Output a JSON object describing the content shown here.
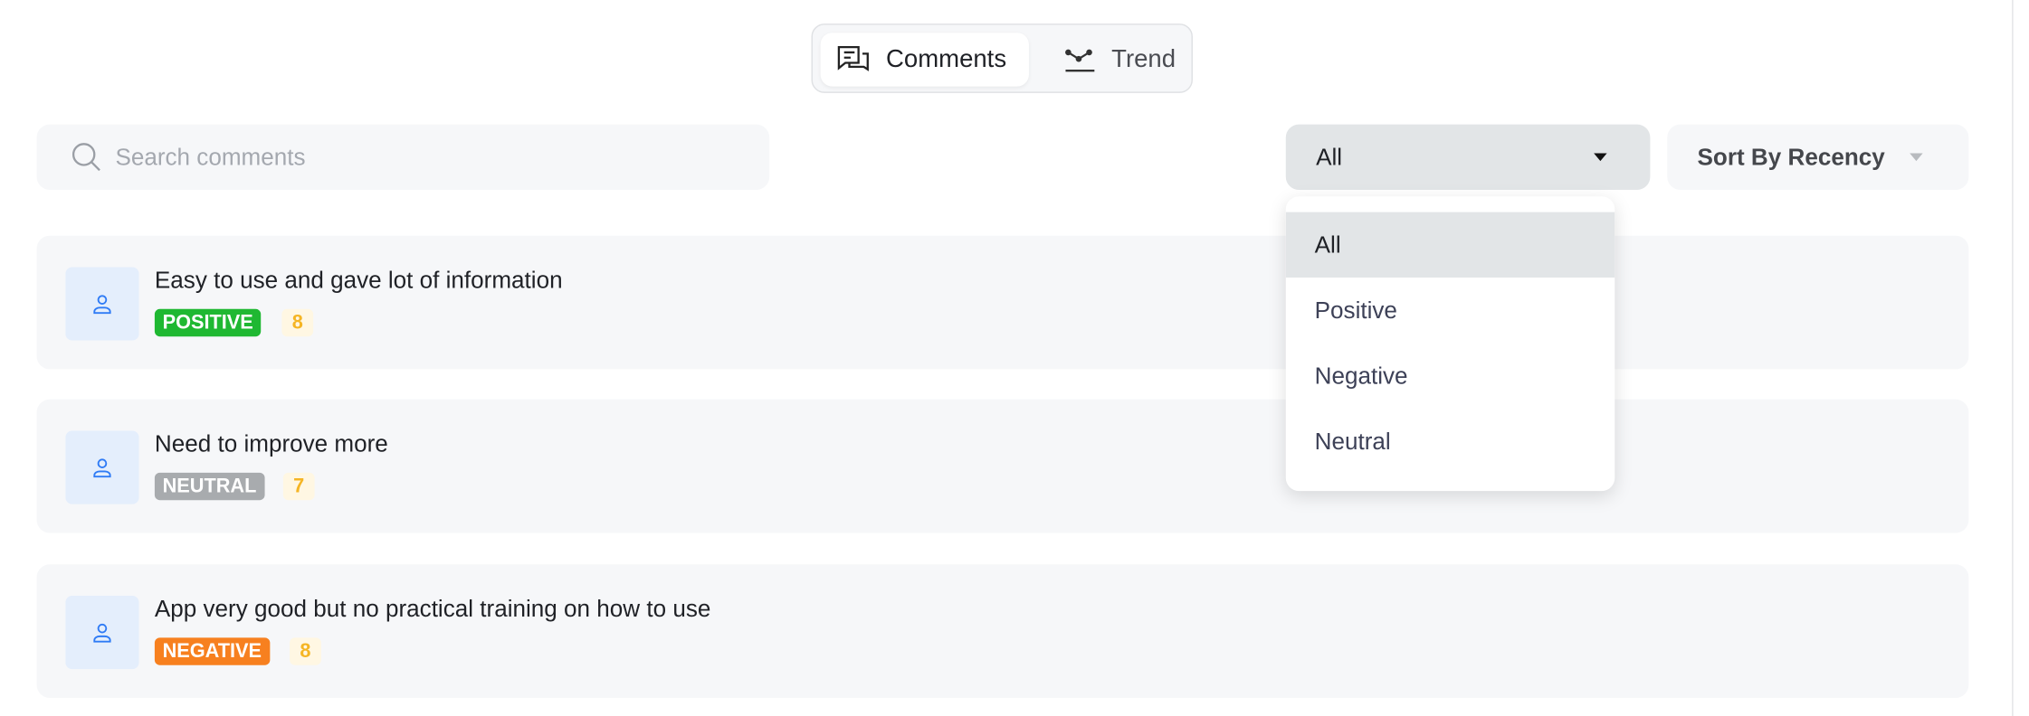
{
  "view_toggle": {
    "tabs": [
      {
        "label": "Comments",
        "icon": "comments-icon",
        "active": true
      },
      {
        "label": "Trend",
        "icon": "trend-icon",
        "active": false
      }
    ]
  },
  "search": {
    "placeholder": "Search comments",
    "value": ""
  },
  "filter": {
    "selected": "All",
    "options": [
      "All",
      "Positive",
      "Negative",
      "Neutral"
    ]
  },
  "sort": {
    "label": "Sort By Recency"
  },
  "colors": {
    "positive": "#1fb832",
    "neutral": "#a8abae",
    "negative": "#f7801f",
    "score": "#f5b524"
  },
  "comments": [
    {
      "text": "Easy to use and gave lot of information",
      "sentiment": "POSITIVE",
      "score": "8"
    },
    {
      "text": "Need to improve more",
      "sentiment": "NEUTRAL",
      "score": "7"
    },
    {
      "text": "App very good but no practical training on how to use",
      "sentiment": "NEGATIVE",
      "score": "8"
    }
  ]
}
